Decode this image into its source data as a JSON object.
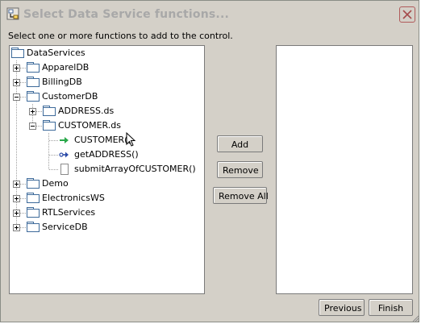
{
  "window": {
    "title": "Select Data Service functions...",
    "instruction": "Select one or more functions to add to the control."
  },
  "tree": {
    "root": "DataServices",
    "nodes": {
      "appareldb": "ApparelDB",
      "billingdb": "BillingDB",
      "customerdb": "CustomerDB",
      "address_ds": "ADDRESS.ds",
      "customer_ds": "CUSTOMER.ds",
      "fn_customer": "CUSTOMER()",
      "fn_getaddress": "getADDRESS()",
      "fn_submitarray": "submitArrayOfCUSTOMER()",
      "demo": "Demo",
      "electronicsws": "ElectronicsWS",
      "rtlservices": "RTLServices",
      "servicedb": "ServiceDB"
    }
  },
  "buttons": {
    "add": "Add",
    "remove": "Remove",
    "remove_all": "Remove All",
    "previous": "Previous",
    "finish": "Finish"
  },
  "colors": {
    "dialog_bg": "#d4d0c8",
    "title_disabled": "#a8a8a8",
    "folder_outline": "#3d6a9a",
    "close_outline": "#b05a5a",
    "function_arrow_green": "#2aa84a",
    "function_arrow_blue": "#2a4aa8"
  },
  "icons": {
    "app": "dialog-app-icon",
    "close": "close-icon",
    "folder": "folder-icon",
    "function_public": "function-green-arrow-icon",
    "function_ref": "function-blue-arrow-icon",
    "function_doc": "document-icon"
  }
}
